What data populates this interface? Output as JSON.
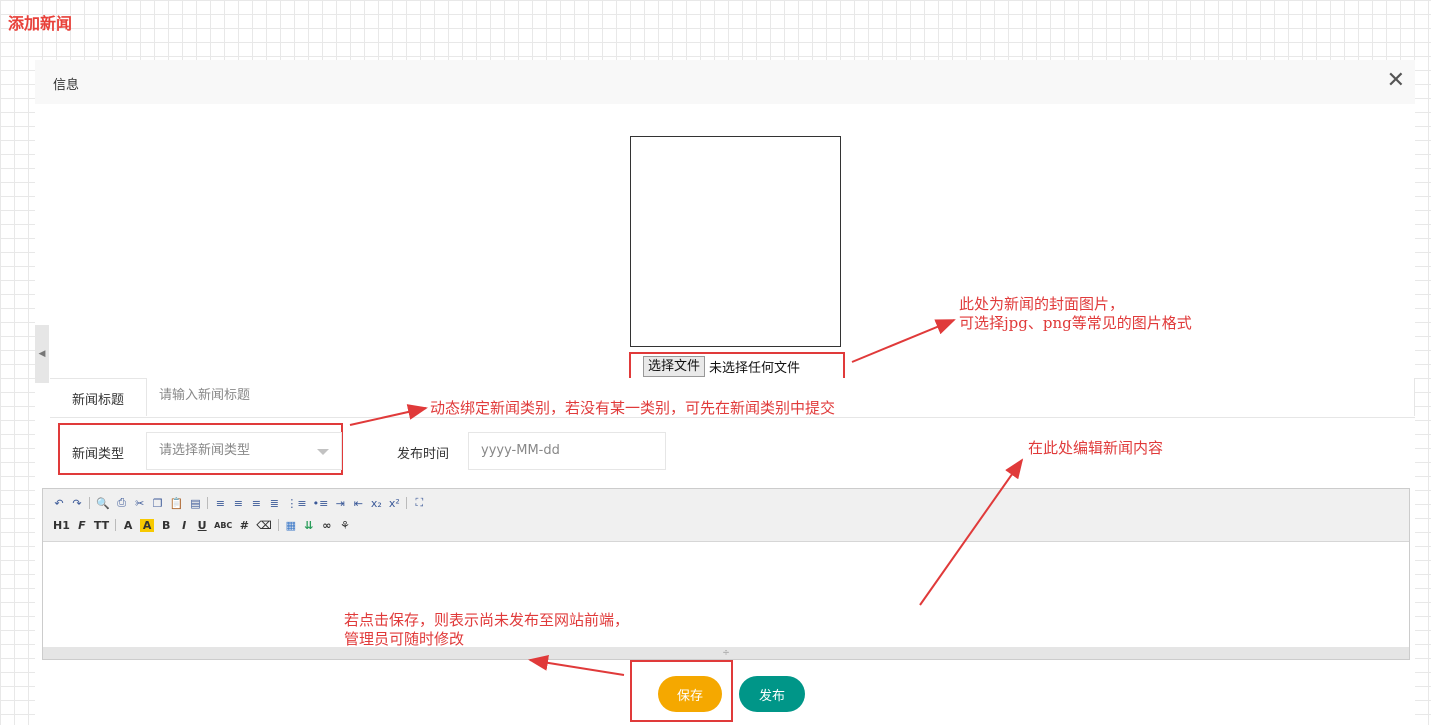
{
  "page": {
    "title": "添加新闻"
  },
  "dialog": {
    "title": "信息",
    "close_icon": "close-icon"
  },
  "cover": {
    "choose_button": "选择文件",
    "file_status": "未选择任何文件"
  },
  "form": {
    "title_label": "新闻标题",
    "title_placeholder": "请输入新闻标题",
    "type_label": "新闻类型",
    "type_placeholder": "请选择新闻类型",
    "time_label": "发布时间",
    "time_placeholder": "yyyy-MM-dd"
  },
  "editor": {
    "toolbar_row1": [
      "undo-icon",
      "redo-icon",
      "preview-icon",
      "print-icon",
      "cut-icon",
      "copy-icon",
      "paste-icon",
      "paste-text-icon",
      "align-left-icon",
      "align-center-icon",
      "align-right-icon",
      "align-justify-icon",
      "ordered-list-icon",
      "unordered-list-icon",
      "indent-icon",
      "outdent-icon",
      "subscript-icon",
      "superscript-icon",
      "fullscreen-icon"
    ],
    "toolbar_row2_labels": {
      "heading": "H1",
      "font": "F",
      "size": "TT",
      "font_color": "A",
      "bg_color": "A",
      "bold": "B",
      "italic": "I",
      "underline": "U",
      "strike": "ABC"
    },
    "toolbar_row2_icons": [
      "hr-icon",
      "eraser-icon",
      "table-icon",
      "insert-icon",
      "link-icon",
      "unlink-icon"
    ]
  },
  "buttons": {
    "save": "保存",
    "publish": "发布"
  },
  "annotations": {
    "cover_line1": "此处为新闻的封面图片，",
    "cover_line2": "可选择jpg、png等常见的图片格式",
    "type_note": "动态绑定新闻类别，若没有某一类别，可先在新闻类别中提交",
    "content_note": "在此处编辑新闻内容",
    "save_line1": "若点击保存，则表示尚未发布至网站前端，",
    "save_line2": "管理员可随时修改"
  },
  "colors": {
    "title_red": "#e8413a",
    "annotation_red": "#e03a3a",
    "save_button": "#f5a800",
    "publish_button": "#009688"
  }
}
